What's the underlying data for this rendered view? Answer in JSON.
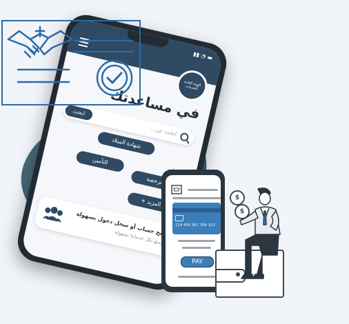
{
  "phone": {
    "title": "في مساعدتك",
    "search": {
      "button_label": "ابحث",
      "placeholder": "ابحث عن..."
    },
    "chips": {
      "birth_certificate": "شهادة الميلاد",
      "license": "الرخصة",
      "insurance": "التأمين",
      "more": "المزيد +"
    },
    "services_label": "الخدمات",
    "card": {
      "title": "افتح حساب أو سجل دخول بسهولة",
      "subtitle": "للتمتع بكل خدماتنا بسهولة"
    },
    "logo_text": "الهيئة العامة للخدمات"
  },
  "payment": {
    "card_number": "124 456 367 789 123",
    "pay_label": "PAY"
  },
  "icons": [
    "menu-icon",
    "search-icon",
    "people-icon",
    "handshake-icon",
    "check-seal-icon",
    "dollar-icon",
    "cart-icon",
    "person-illustration"
  ],
  "colors": {
    "primary": "#2f4a62",
    "accent": "#3b7fb8",
    "outline": "#2b6aa6"
  },
  "dollar_symbol": "$"
}
